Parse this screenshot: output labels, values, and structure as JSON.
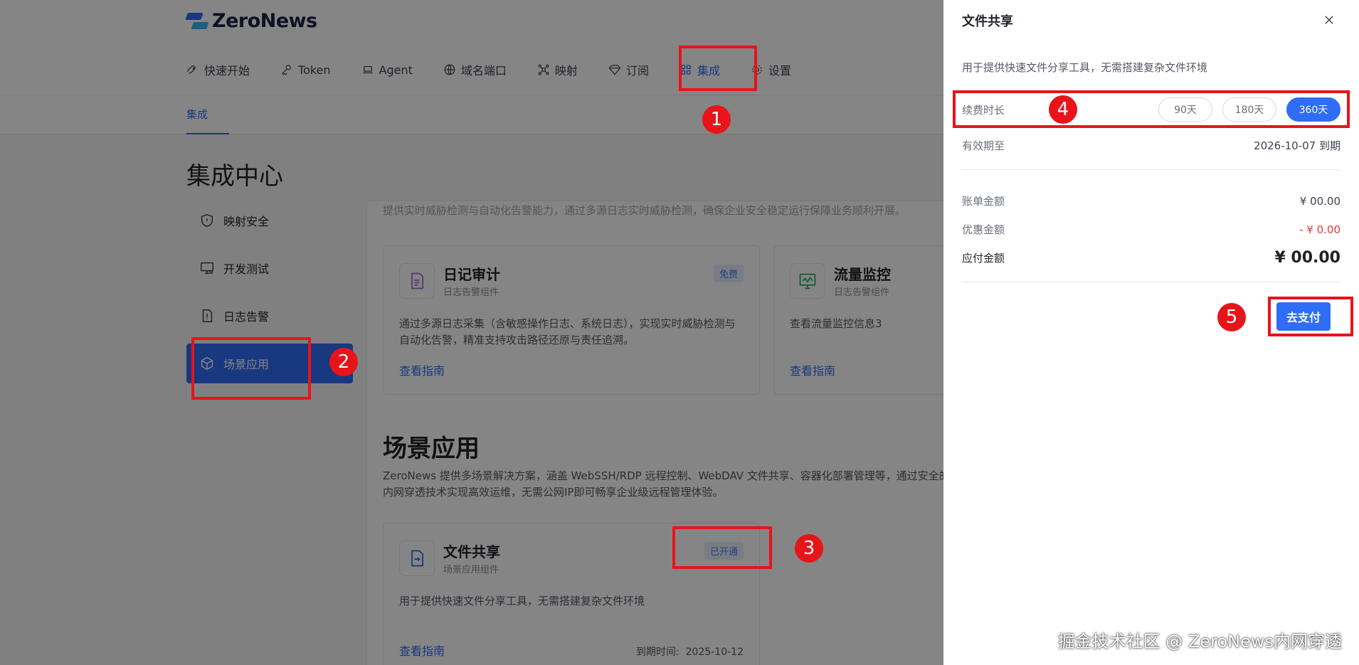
{
  "brand": {
    "name": "ZeroNews"
  },
  "nav": [
    {
      "label": "快速开始",
      "icon": "rocket-icon",
      "active": false
    },
    {
      "label": "Token",
      "icon": "key-icon",
      "active": false
    },
    {
      "label": "Agent",
      "icon": "laptop-icon",
      "active": false
    },
    {
      "label": "域名端口",
      "icon": "globe-icon",
      "active": false
    },
    {
      "label": "映射",
      "icon": "network-icon",
      "active": false
    },
    {
      "label": "订阅",
      "icon": "diamond-icon",
      "active": false
    },
    {
      "label": "集成",
      "icon": "grid-icon",
      "active": true
    },
    {
      "label": "设置",
      "icon": "gear-icon",
      "active": false
    }
  ],
  "subtab": {
    "label": "集成"
  },
  "page": {
    "title": "集成中心"
  },
  "sidebar": {
    "items": [
      {
        "label": "映射安全",
        "icon": "shield-icon"
      },
      {
        "label": "开发测试",
        "icon": "monitor-code-icon"
      },
      {
        "label": "日志告警",
        "icon": "document-alert-icon"
      },
      {
        "label": "场景应用",
        "icon": "cube-icon"
      }
    ]
  },
  "content": {
    "top_text": "提供实时威胁检测与自动化告警能力，通过多源日志实时威胁检测，确保企业安全稳定运行保障业务顺利开展。",
    "log_cards": [
      {
        "title": "日记审计",
        "subtitle": "日志告警组件",
        "badge": "免费",
        "desc": "通过多源日志采集（含敏感操作日志、系统日志），实现实时威胁检测与自动化告警，精准支持攻击路径还原与责任追溯。",
        "link": "查看指南"
      },
      {
        "title": "流量监控",
        "subtitle": "日志告警组件",
        "desc": "查看流量监控信息3",
        "link": "查看指南"
      }
    ],
    "scene": {
      "title": "场景应用",
      "desc": "ZeroNews 提供多场景解决方案，涵盖 WebSSH/RDP 远程控制、WebDAV 文件共享、容器化部署管理等，通过安全的内网穿透技术实现高效运维，无需公网IP即可畅享企业级远程管理体验。",
      "card": {
        "title": "文件共享",
        "subtitle": "场景应用组件",
        "badge": "已开通",
        "desc": "用于提供快速文件分享工具，无需搭建复杂文件环境",
        "link": "查看指南",
        "expire_label": "到期时间:",
        "expire_value": "2025-10-12"
      }
    }
  },
  "drawer": {
    "title": "文件共享",
    "desc": "用于提供快速文件分享工具，无需搭建复杂文件环境",
    "renew_label": "续费时长",
    "options": [
      "90天",
      "180天",
      "360天"
    ],
    "selected_option": "360天",
    "valid_label": "有效期至",
    "valid_value": "2026-10-07 到期",
    "bill_label": "账单金额",
    "bill_value": "¥ 00.00",
    "discount_label": "优惠金额",
    "discount_value": "- ¥ 0.00",
    "pay_label": "应付金额",
    "pay_value": "¥ 00.00",
    "pay_button": "去支付"
  },
  "annotations": [
    "1",
    "2",
    "3",
    "4",
    "5"
  ],
  "watermark": "掘金技术社区 @ ZeroNews内网穿透",
  "colors": {
    "accent": "#2f6df6",
    "annotation": "#e8141a",
    "discount": "#e03b3b"
  }
}
